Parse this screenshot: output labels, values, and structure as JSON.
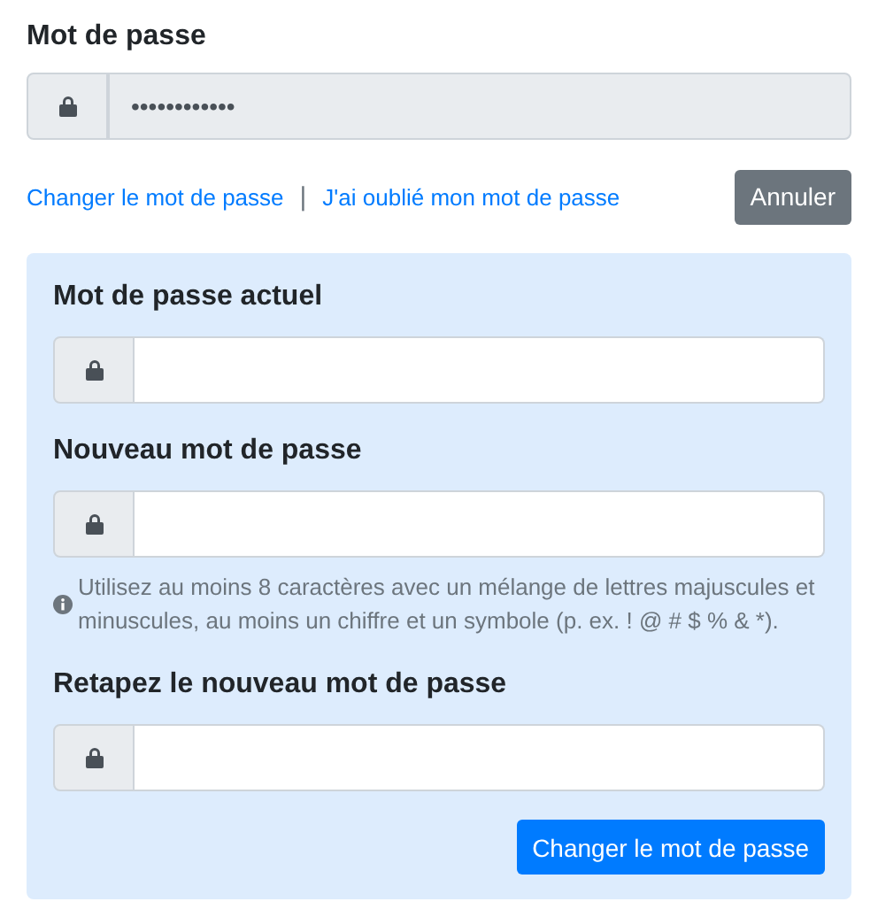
{
  "current": {
    "title": "Mot de passe",
    "value": "••••••••••••",
    "disabled": true
  },
  "links": [
    "Changer le mot de passe",
    "J'ai oublié mon mot de passe"
  ],
  "separator": "|",
  "cancel_button": "Annuler",
  "form": {
    "fields": [
      {
        "label": "Mot de passe actuel"
      },
      {
        "label": "Nouveau mot de passe",
        "hint": "Utilisez au moins 8 caractères avec un mélange de lettres majuscules et minuscules, au moins un chiffre et un symbole (p. ex. ! @ # $ % & *)."
      },
      {
        "label": "Retapez le nouveau mot de passe"
      }
    ],
    "submit_button": "Changer le mot de passe"
  }
}
